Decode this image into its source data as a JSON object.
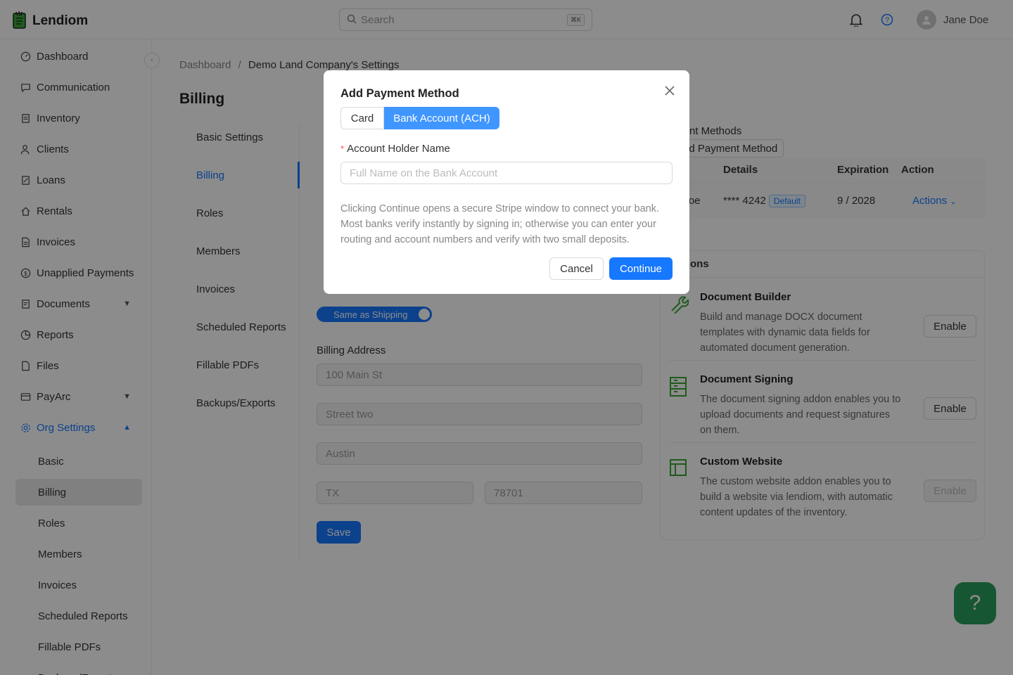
{
  "app": {
    "name": "Lendiom"
  },
  "search": {
    "placeholder": "Search",
    "shortcut": "⌘K"
  },
  "user": {
    "name": "Jane Doe"
  },
  "colors": {
    "primary": "#1677ff",
    "overlay": "rgba(0,0,0,0.45)",
    "fab": "#2a9d5c",
    "addon_icon": "#3aa635"
  },
  "sidebar": {
    "items": [
      {
        "label": "Dashboard",
        "icon": "dashboard-icon"
      },
      {
        "label": "Communication",
        "icon": "chat-icon"
      },
      {
        "label": "Inventory",
        "icon": "inventory-icon"
      },
      {
        "label": "Clients",
        "icon": "clients-icon"
      },
      {
        "label": "Loans",
        "icon": "loans-icon"
      },
      {
        "label": "Rentals",
        "icon": "home-icon"
      },
      {
        "label": "Invoices",
        "icon": "invoice-icon"
      },
      {
        "label": "Unapplied Payments",
        "icon": "dollar-icon"
      },
      {
        "label": "Documents",
        "icon": "documents-icon"
      },
      {
        "label": "Reports",
        "icon": "pie-icon"
      },
      {
        "label": "Files",
        "icon": "file-icon"
      },
      {
        "label": "PayArc",
        "icon": "card-icon"
      },
      {
        "label": "Org Settings",
        "icon": "gear-icon"
      }
    ],
    "sub_items": [
      "Basic",
      "Billing",
      "Roles",
      "Members",
      "Invoices",
      "Scheduled Reports",
      "Fillable PDFs",
      "Backups/Exports"
    ]
  },
  "breadcrumb": {
    "root": "Dashboard",
    "sep": "/",
    "current": "Demo Land Company's Settings"
  },
  "page": {
    "title": "Billing"
  },
  "settings_nav": [
    "Basic Settings",
    "Billing",
    "Roles",
    "Members",
    "Invoices",
    "Scheduled Reports",
    "Fillable PDFs",
    "Backups/Exports"
  ],
  "form": {
    "toggle_label": "Same as Shipping",
    "billing_address_label": "Billing Address",
    "street1": "100 Main St",
    "street2_placeholder": "Street two",
    "city": "Austin",
    "state": "TX",
    "zip": "78701",
    "save_label": "Save"
  },
  "payment_methods": {
    "title_partial": "nt Methods",
    "add_partial": "dd Payment Method",
    "headers": {
      "name_partial": "e",
      "details": "Details",
      "expiration": "Expiration",
      "action": "Action"
    },
    "row": {
      "name_partial": "Doe",
      "details": "**** 4242",
      "badge": "Default",
      "expiration": "9 / 2028",
      "action": "Actions"
    }
  },
  "addons": {
    "header_partial": "ons",
    "items": [
      {
        "name": "Document Builder",
        "desc": "Build and manage DOCX document templates with dynamic data fields for automated document generation.",
        "button": "Enable",
        "icon": "wrench-icon"
      },
      {
        "name": "Document Signing",
        "desc": "The document signing addon enables you to upload documents and request signatures on them.",
        "button": "Enable",
        "icon": "signing-icon"
      },
      {
        "name": "Custom Website",
        "desc": "The custom website addon enables you to build a website via lendiom, with automatic content updates of the inventory.",
        "button": "Enable",
        "icon": "layout-icon"
      }
    ]
  },
  "modal": {
    "title": "Add Payment Method",
    "tab_card": "Card",
    "tab_bank": "Bank Account (ACH)",
    "field_label": "Account Holder Name",
    "field_placeholder": "Full Name on the Bank Account",
    "info": "Clicking Continue opens a secure Stripe window to connect your bank. Most banks verify instantly by signing in; otherwise you can enter your routing and account numbers and verify with two small deposits.",
    "cancel": "Cancel",
    "continue": "Continue"
  },
  "fab": {
    "label": "?"
  }
}
